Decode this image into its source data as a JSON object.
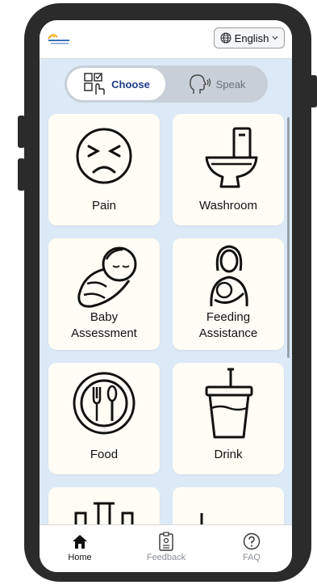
{
  "colors": {
    "screen_bg": "#dce9f7",
    "card_bg": "#fffdf5",
    "active_tab_text": "#1d3a8a",
    "inactive_text": "#6a6f7a"
  },
  "header": {
    "language_label": "English",
    "logo_icon": "brightstar-logo-icon"
  },
  "mode_toggle": {
    "choose": {
      "label": "Choose",
      "icon": "choose-grid-icon",
      "active": true
    },
    "speak": {
      "label": "Speak",
      "icon": "speaking-head-icon",
      "active": false
    }
  },
  "cards": [
    {
      "label": "Pain",
      "icon": "pain-face-icon"
    },
    {
      "label": "Washroom",
      "icon": "toilet-icon"
    },
    {
      "label": "Baby Assessment",
      "line1": "Baby",
      "line2": "Assessment",
      "icon": "swaddled-baby-icon"
    },
    {
      "label": "Feeding Assistance",
      "line1": "Feeding",
      "line2": "Assistance",
      "icon": "breastfeeding-icon"
    },
    {
      "label": "Food",
      "icon": "plate-utensils-icon"
    },
    {
      "label": "Drink",
      "icon": "cup-straw-icon"
    },
    {
      "label": "",
      "icon": "partially-visible-icon"
    },
    {
      "label": "",
      "icon": "partially-visible-icon"
    }
  ],
  "bottom_nav": [
    {
      "label": "Home",
      "icon": "home-icon",
      "active": true
    },
    {
      "label": "Feedback",
      "icon": "clipboard-icon",
      "active": false
    },
    {
      "label": "FAQ",
      "icon": "question-circle-icon",
      "active": false
    }
  ]
}
